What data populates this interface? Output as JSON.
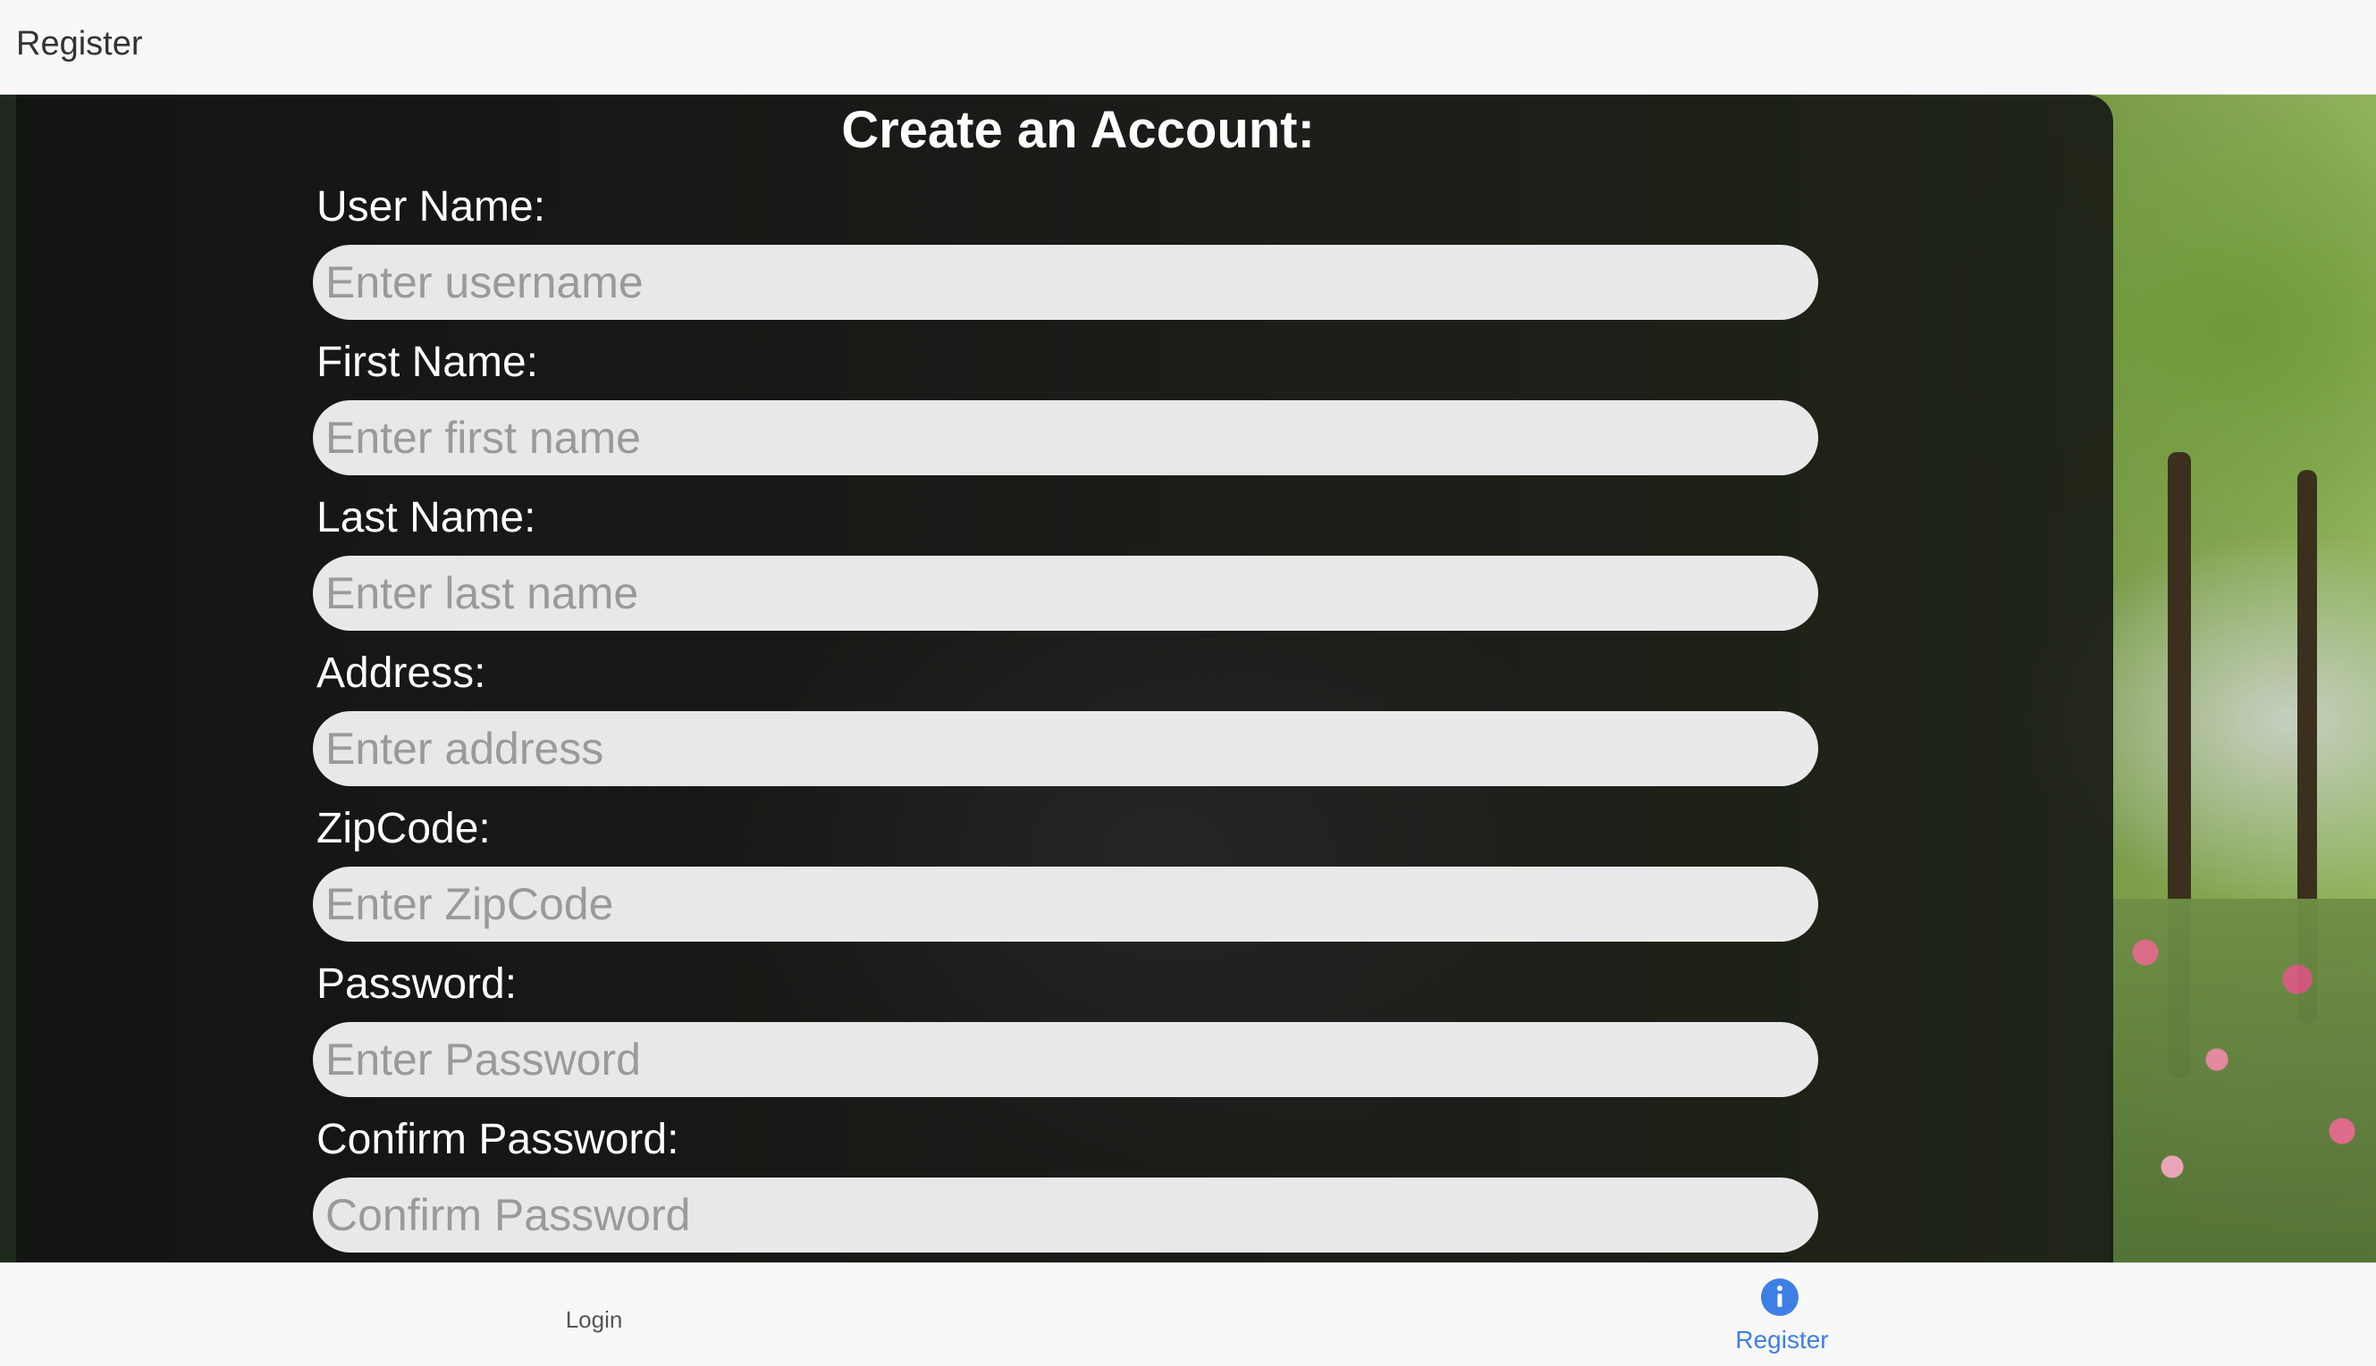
{
  "header": {
    "title": "Register"
  },
  "form": {
    "title": "Create an Account:",
    "fields": [
      {
        "label": "User Name:",
        "placeholder": "Enter username"
      },
      {
        "label": "First Name:",
        "placeholder": "Enter first name"
      },
      {
        "label": "Last Name:",
        "placeholder": "Enter last name"
      },
      {
        "label": "Address:",
        "placeholder": "Enter address"
      },
      {
        "label": "ZipCode:",
        "placeholder": "Enter ZipCode"
      },
      {
        "label": "Password:",
        "placeholder": "Enter Password"
      },
      {
        "label": "Confirm Password:",
        "placeholder": "Confirm Password"
      }
    ]
  },
  "tabbar": {
    "tabs": [
      {
        "label": "Login",
        "active": false
      },
      {
        "label": "Register",
        "active": true,
        "icon": "info-icon"
      }
    ],
    "active_color": "#3e7fe6"
  },
  "colors": {
    "overlay": "#121212",
    "header_bg": "#f8f8f8",
    "accent": "#3e7fe6"
  }
}
